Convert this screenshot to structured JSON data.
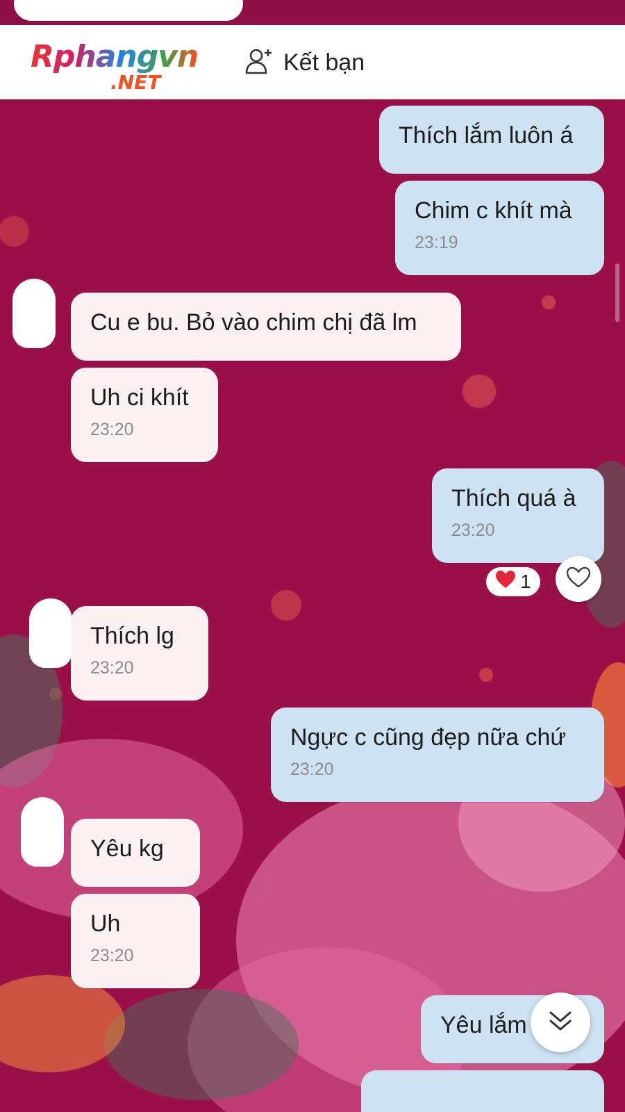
{
  "header": {
    "logo_main": "Rphangvn",
    "logo_sub": ".NET",
    "add_friend_label": "Kết bạn",
    "add_friend_icon": "add-user-icon"
  },
  "messages": [
    {
      "side": "out",
      "text": "Thích lắm luôn á",
      "time": ""
    },
    {
      "side": "out",
      "text": "Chim c khít mà",
      "time": "23:19"
    },
    {
      "side": "in",
      "text": "Cu e bu. Bỏ vào chim chị đã lm",
      "time": ""
    },
    {
      "side": "in",
      "text": "Uh ci khít",
      "time": "23:20"
    },
    {
      "side": "out",
      "text": "Thích quá à",
      "time": "23:20"
    },
    {
      "side": "in",
      "text": "Thích lg",
      "time": "23:20"
    },
    {
      "side": "out",
      "text": "Ngực c cũng đẹp nữa chứ",
      "time": "23:20"
    },
    {
      "side": "in",
      "text": "Yêu kg",
      "time": ""
    },
    {
      "side": "in",
      "text": "Uh",
      "time": "23:20"
    },
    {
      "side": "out",
      "text": "Yêu lắm luôn",
      "time": ""
    }
  ],
  "reaction": {
    "emoji": "❤️",
    "count": "1"
  },
  "icons": {
    "like": "heart-icon",
    "scroll": "double-chevron-down-icon"
  },
  "colors": {
    "background": "#9b1049",
    "outgoing_bubble": "#cde3f3",
    "incoming_bubble": "#fbf1f3"
  }
}
